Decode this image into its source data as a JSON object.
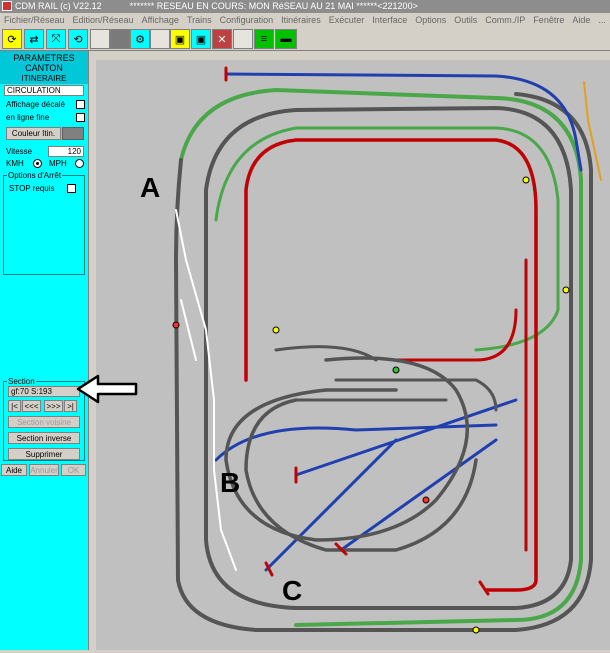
{
  "titlebar": {
    "app": "CDM RAIL (c) V22.12",
    "network": "******* RESEAU EN COURS: MON RéSEAU AU 21 MAI ******<221200>"
  },
  "menubar": [
    "Fichier/Réseau",
    "Edition/Réseau",
    "Affichage",
    "Trains",
    "Configuration",
    "Itinéraires",
    "Exécuter",
    "Interface",
    "Options",
    "Outils",
    "Comm./IP",
    "Fenêtre",
    "Aide",
    "..."
  ],
  "panel": {
    "header": "PARAMETRES\nCANTON",
    "itin_label": "ITINERAIRE",
    "itin_value": "CIRCULATION",
    "affichage_decale": "Affichage décalé",
    "en_ligne_fine": "en ligne fine",
    "couleur_itin": "Couleur Itin.",
    "vitesse_label": "Vitesse",
    "vitesse_value": "120",
    "kmh": "KMH",
    "mph": "MPH",
    "options_arret": "Options d'Arrêt",
    "stop_requis": "STOP requis",
    "section_title": "Section",
    "section_value": "gf:70 S:193",
    "nav_first": "|<",
    "nav_prev": "<<<",
    "nav_next": ">>>",
    "nav_last": ">|",
    "section_voisine": "Section voisine",
    "section_inverse": "Section inverse",
    "supprimer": "Supprimer",
    "aide": "Aide",
    "annuler": "Annuler",
    "ok": "OK"
  },
  "markers": {
    "a": "A",
    "b": "B",
    "c": "C"
  },
  "colors": {
    "map_bg": "#c0c0c0",
    "track_gray": "#555555",
    "track_red": "#c00000",
    "track_blue": "#2040b0",
    "track_green": "#40b040",
    "selected": "#ffffff"
  }
}
